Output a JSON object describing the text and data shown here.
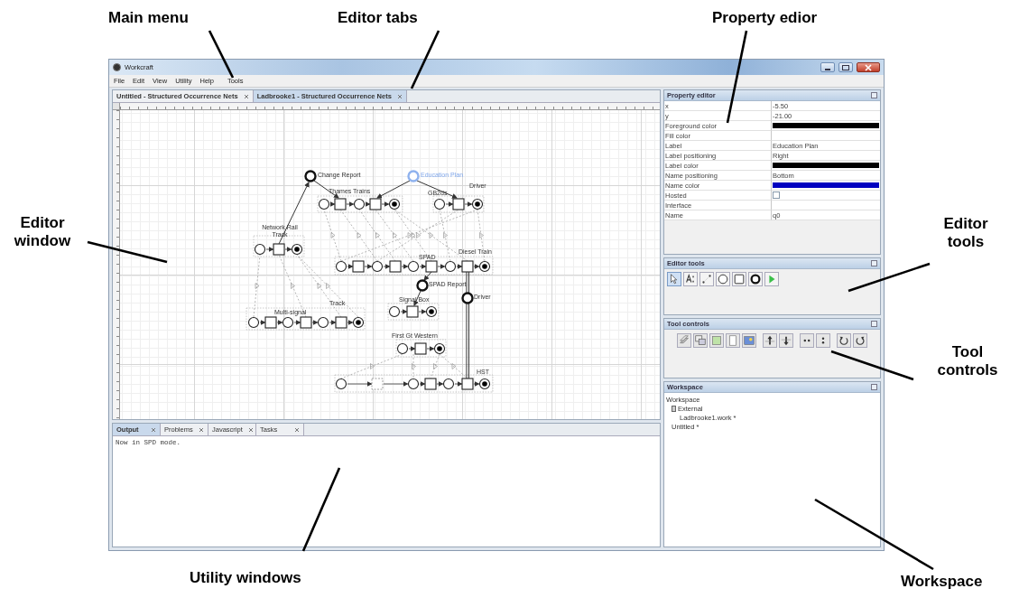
{
  "annotations": [
    {
      "text": "Main menu"
    },
    {
      "text": "Editor tabs"
    },
    {
      "text": "Property edior"
    },
    {
      "text": "Editor window"
    },
    {
      "text": "Editor tools"
    },
    {
      "text": "Tool controls"
    },
    {
      "text": "Utility windows"
    },
    {
      "text": "Workspace"
    }
  ],
  "window": {
    "title": "Workcraft"
  },
  "menu": [
    "File",
    "Edit",
    "View",
    "Utility",
    "Help",
    "Tools"
  ],
  "editor_tabs": [
    {
      "label": "Untitled - Structured Occurrence Nets",
      "selected": false
    },
    {
      "label": "Ladbrooke1 - Structured Occurrence Nets",
      "selected": true
    }
  ],
  "diagram": {
    "labels": [
      {
        "text": "Change Report",
        "selected": false
      },
      {
        "text": "Education Plan",
        "selected": true
      },
      {
        "text": "Thames Trains",
        "selected": false
      },
      {
        "text": "Driver",
        "selected": false
      },
      {
        "text": "GB2ds",
        "selected": false
      },
      {
        "text": "Network Rail Track",
        "selected": false
      },
      {
        "text": "SPAD",
        "selected": false
      },
      {
        "text": "Diesel Train",
        "selected": false
      },
      {
        "text": "SPAD Report",
        "selected": false
      },
      {
        "text": "Signal Box",
        "selected": false
      },
      {
        "text": "Driver",
        "selected": false
      },
      {
        "text": "Multi-signal",
        "selected": false
      },
      {
        "text": "Track",
        "selected": false
      },
      {
        "text": "First Gt Western",
        "selected": false
      },
      {
        "text": "HST",
        "selected": false
      }
    ]
  },
  "utility": {
    "tabs": [
      {
        "label": "Output",
        "selected": true
      },
      {
        "label": "Problems",
        "selected": false
      },
      {
        "label": "Javascript",
        "selected": false
      },
      {
        "label": "Tasks",
        "selected": false
      }
    ],
    "output": "Now in SPD mode."
  },
  "property_editor": {
    "title": "Property editor",
    "rows": [
      {
        "name": "x",
        "kind": "text",
        "value": "-5.50"
      },
      {
        "name": "y",
        "kind": "text",
        "value": "-21.00"
      },
      {
        "name": "Foreground color",
        "kind": "color",
        "color": "#000000"
      },
      {
        "name": "Fill color",
        "kind": "empty"
      },
      {
        "name": "Label",
        "kind": "text",
        "value": "Education Plan"
      },
      {
        "name": "Label positioning",
        "kind": "text",
        "value": "Right"
      },
      {
        "name": "Label color",
        "kind": "color",
        "color": "#000000"
      },
      {
        "name": "Name positioning",
        "kind": "text",
        "value": "Bottom"
      },
      {
        "name": "Name color",
        "kind": "color",
        "color": "#0000c0"
      },
      {
        "name": "Hosted",
        "kind": "checkbox",
        "checked": false
      },
      {
        "name": "Interface",
        "kind": "empty"
      },
      {
        "name": "Name",
        "kind": "text",
        "value": "q0"
      }
    ]
  },
  "editor_tools": {
    "title": "Editor tools",
    "tools": [
      {
        "kind": "select",
        "selected": true
      },
      {
        "kind": "text",
        "selected": false
      },
      {
        "kind": "connect",
        "selected": false
      },
      {
        "kind": "place",
        "selected": false
      },
      {
        "kind": "transition",
        "selected": false
      },
      {
        "kind": "bold-place",
        "selected": false
      },
      {
        "kind": "simulate",
        "selected": false
      }
    ]
  },
  "tool_controls": {
    "title": "Tool controls",
    "controls": [
      {
        "kind": "stack"
      },
      {
        "kind": "windows"
      },
      {
        "kind": "square"
      },
      {
        "kind": "page"
      },
      {
        "kind": "picture"
      },
      {
        "kind": "up"
      },
      {
        "kind": "down"
      },
      {
        "kind": "dots-h"
      },
      {
        "kind": "dots-v"
      },
      {
        "kind": "rotate-left"
      },
      {
        "kind": "rotate-right"
      }
    ]
  },
  "workspace": {
    "title": "Workspace",
    "tree": [
      {
        "label": "Workspace",
        "children": [
          {
            "label": "External",
            "expanded": true,
            "children": [
              {
                "label": "Ladbrooke1.work *"
              }
            ]
          },
          {
            "label": "Untitled *"
          }
        ]
      }
    ]
  }
}
